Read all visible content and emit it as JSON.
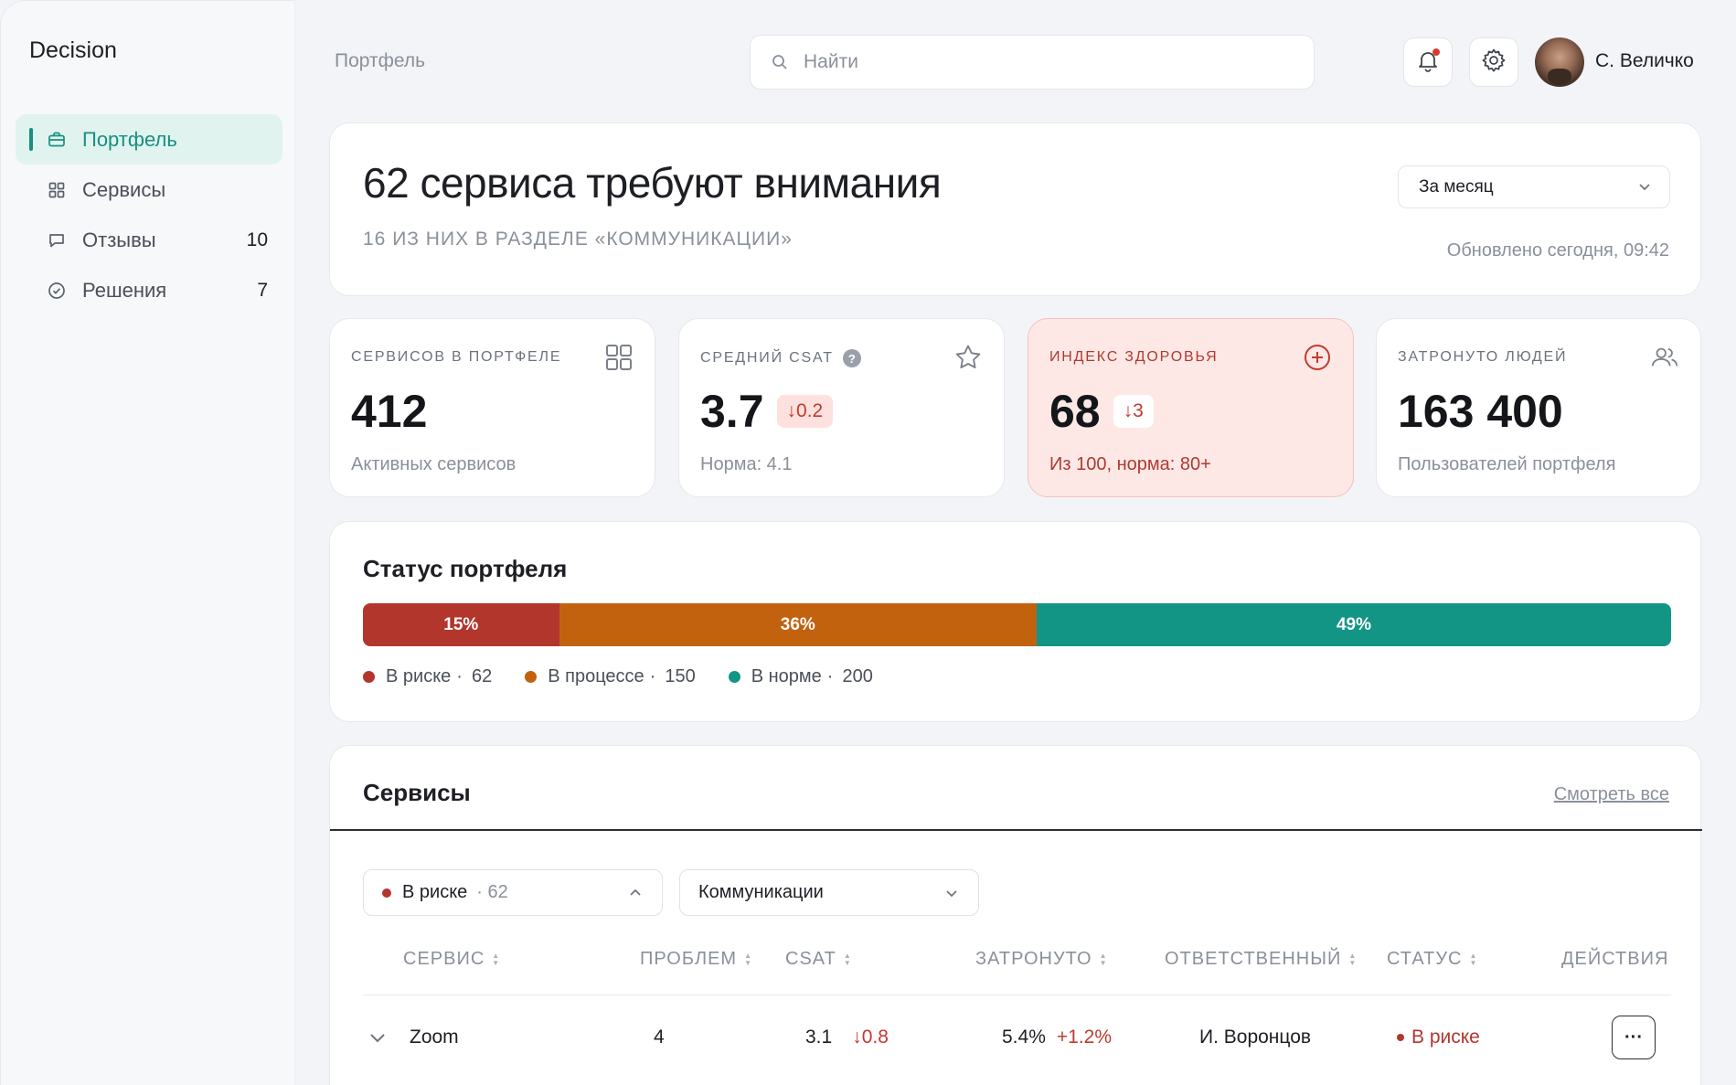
{
  "app": {
    "brand": "Decision",
    "page_title": "Портфель"
  },
  "sidebar": {
    "items": [
      {
        "label": "Портфель",
        "icon": "briefcase-icon",
        "count": "",
        "active": true
      },
      {
        "label": "Сервисы",
        "icon": "grid-icon",
        "count": ""
      },
      {
        "label": "Отзывы",
        "icon": "chat-icon",
        "count": "10"
      },
      {
        "label": "Решения",
        "icon": "check-circle-icon",
        "count": "7"
      }
    ]
  },
  "header": {
    "search_placeholder": "Найти",
    "user_name": "С. Величко"
  },
  "hero": {
    "title": "62 сервиса требуют внимания",
    "subtitle": "16 ИЗ НИХ В РАЗДЕЛЕ «КОММУНИКАЦИИ»",
    "period": "За месяц",
    "updated": "Обновлено сегодня, 09:42"
  },
  "kpis": [
    {
      "label": "СЕРВИСОВ В ПОРТФЕЛЕ",
      "value": "412",
      "delta": "",
      "sub": "Активных сервисов",
      "icon": "grid-icon"
    },
    {
      "label": "СРЕДНИЙ CSAT",
      "value": "3.7",
      "delta": "↓0.2",
      "sub": "Норма: 4.1",
      "icon": "star-icon",
      "help": "?"
    },
    {
      "label": "ИНДЕКС ЗДОРОВЬЯ",
      "value": "68",
      "delta": "↓3",
      "sub": "Из 100, норма: 80+",
      "icon": "plus-circle-icon"
    },
    {
      "label": "ЗАТРОНУТО ЛЮДЕЙ",
      "value": "163 400",
      "delta": "",
      "sub": "Пользователей портфеля",
      "icon": "users-icon"
    }
  ],
  "portfolio_status": {
    "title": "Статус портфеля",
    "segments": [
      {
        "label": "15%",
        "name": "В риске",
        "count": "62",
        "percent": 15,
        "color": "#b3362c"
      },
      {
        "label": "36%",
        "name": "В процессе",
        "count": "150",
        "percent": 36.5,
        "color": "#c2620f"
      },
      {
        "label": "49%",
        "name": "В норме",
        "count": "200",
        "percent": 48.5,
        "color": "#139586"
      }
    ],
    "separator": "·"
  },
  "services": {
    "title": "Сервисы",
    "see_all": "Смотреть все",
    "filters": {
      "status": {
        "label": "В риске",
        "count": "· 62"
      },
      "category": "Коммуникации"
    },
    "columns": [
      "СЕРВИС",
      "ПРОБЛЕМ",
      "CSAT",
      "ЗАТРОНУТО",
      "ОТВЕТСТВЕННЫЙ",
      "СТАТУС",
      "ДЕЙСТВИЯ"
    ],
    "rows": [
      {
        "service": "Zoom",
        "problems": "4",
        "csat": "3.1",
        "csat_delta": "↓0.8",
        "affected": "5.4%",
        "affected_delta": "+1.2%",
        "owner": "И. Воронцов",
        "status": "В риске",
        "actions": "···"
      }
    ]
  }
}
